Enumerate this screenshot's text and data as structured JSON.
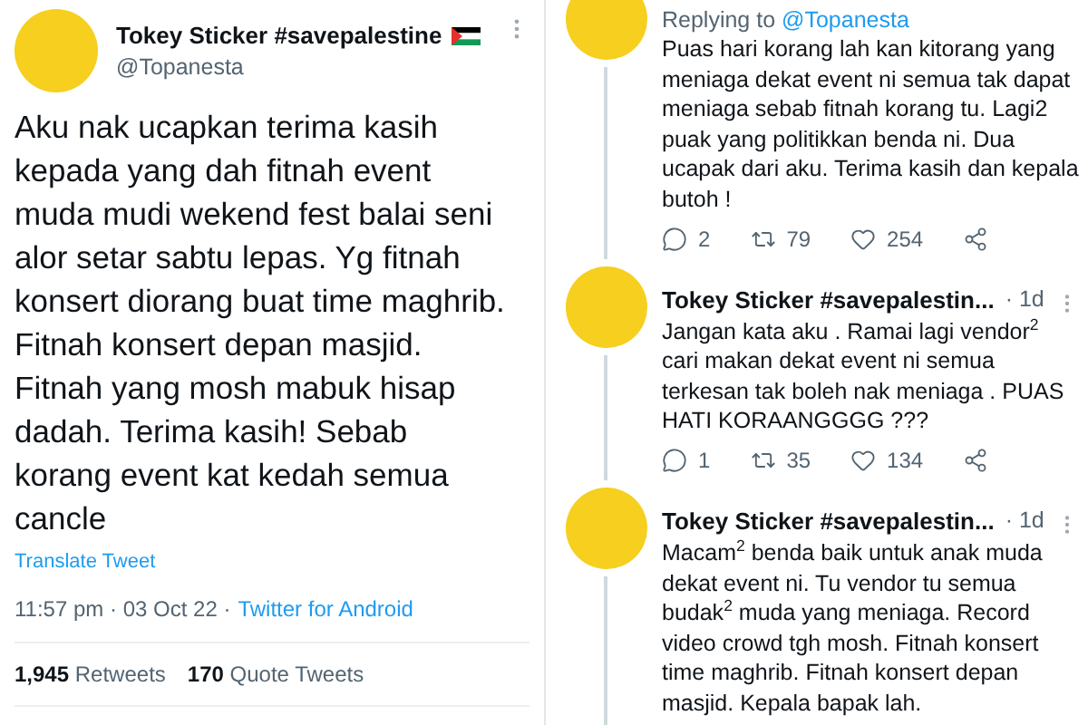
{
  "main_tweet": {
    "display_name": "Tokey Sticker #savepalestine",
    "handle": "@Topanesta",
    "text": "Aku nak ucapkan terima kasih kepada yang dah fitnah event muda mudi wekend fest balai seni alor setar sabtu lepas. Yg fitnah konsert diorang buat time maghrib. Fitnah konsert depan masjid. Fitnah yang mosh mabuk hisap dadah. Terima kasih! Sebab korang event kat kedah semua cancle",
    "translate_link": "Translate Tweet",
    "time": "11:57 pm",
    "date": "03 Oct 22",
    "separator": "·",
    "source": "Twitter for Android",
    "stats": [
      {
        "count": "1,945",
        "label": "Retweets"
      },
      {
        "count": "170",
        "label": "Quote Tweets"
      }
    ]
  },
  "replies": [
    {
      "replying_label": "Replying to",
      "replying_handle": "@Topanesta",
      "text": "Puas hari korang lah kan kitorang yang meniaga dekat event ni semua tak dapat meniaga sebab fitnah korang tu. Lagi2 puak yang politikkan benda ni. Dua ucapak dari aku. Terima kasih dan kepala butoh !",
      "actions": [
        {
          "kind": "reply",
          "count": "2"
        },
        {
          "kind": "retweet",
          "count": "79"
        },
        {
          "kind": "like",
          "count": "254"
        },
        {
          "kind": "share"
        }
      ]
    },
    {
      "display_name": "Tokey Sticker #savepalestin...",
      "age": "· 1d",
      "text": "Jangan kata aku . Ramai lagi vendor$^{2}$ cari makan dekat event ni semua terkesan tak boleh nak meniaga . PUAS HATI KORAANGGGG ???",
      "actions": [
        {
          "kind": "reply",
          "count": "1"
        },
        {
          "kind": "retweet",
          "count": "35"
        },
        {
          "kind": "like",
          "count": "134"
        },
        {
          "kind": "share"
        }
      ]
    },
    {
      "display_name": "Tokey Sticker #savepalestin...",
      "age": "· 1d",
      "text": "Macam$^{2}$ benda baik untuk anak muda dekat event ni. Tu vendor tu semua budak$^{2}$ muda yang meniaga. Record video crowd tgh mosh. Fitnah konsert time maghrib. Fitnah konsert depan masjid. Kepala bapak lah."
    }
  ]
}
